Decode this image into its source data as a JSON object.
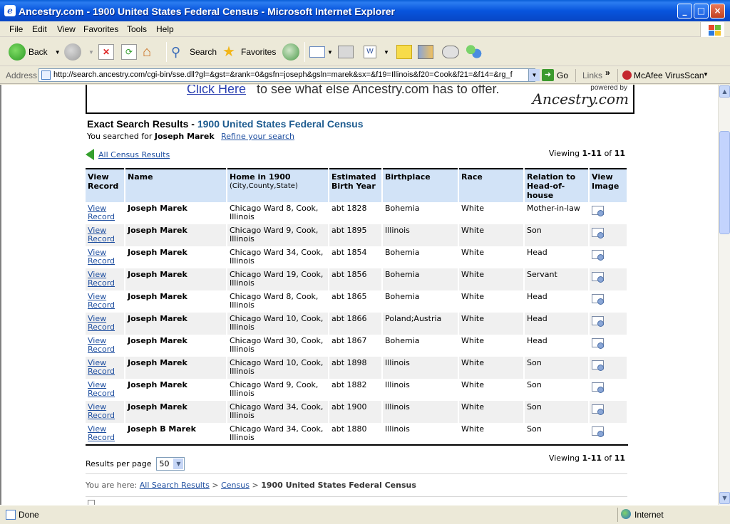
{
  "window": {
    "title": "Ancestry.com - 1900 United States Federal Census - Microsoft Internet Explorer",
    "minimize": "_",
    "maximize": "□",
    "close": "×"
  },
  "menu": [
    "File",
    "Edit",
    "View",
    "Favorites",
    "Tools",
    "Help"
  ],
  "toolbar": {
    "back_label": "Back",
    "search_label": "Search",
    "favorites_label": "Favorites"
  },
  "address": {
    "label": "Address",
    "url": "http://search.ancestry.com/cgi-bin/sse.dll?gl=&gst=&rank=0&gsfn=joseph&gsln=marek&sx=&f19=Illinois&f20=Cook&f21=&f14=&rg_f",
    "go_label": "Go",
    "links_label": "Links",
    "mcafee_label": "McAfee VirusScan"
  },
  "ad": {
    "link_text": "Click Here",
    "text": "to see what else Ancestry.com has to offer.",
    "powered_by": "powered by",
    "logo": "Ancestry.com"
  },
  "results": {
    "title": "Exact Search Results - ",
    "collection": "1900 United States Federal Census",
    "searched_prefix": "You searched for",
    "searched_name": "Joseph Marek",
    "refine": "Refine your search",
    "all_census": "All Census Results",
    "viewing_prefix": "Viewing",
    "viewing_range": "1-11",
    "viewing_of": "of",
    "viewing_total": "11"
  },
  "table": {
    "headers": {
      "view_record": "View Record",
      "name": "Name",
      "home": "Home in 1900",
      "home_sub": "(City,County,State)",
      "birth_year": "Estimated Birth Year",
      "birthplace": "Birthplace",
      "race": "Race",
      "relation": "Relation to Head-of-house",
      "view_image": "View Image"
    },
    "rows": [
      {
        "view": "View Record",
        "name": "Joseph Marek",
        "home": "Chicago Ward 8, Cook, Illinois",
        "year": "abt 1828",
        "birthplace": "Bohemia",
        "race": "White",
        "relation": "Mother-in-law"
      },
      {
        "view": "View Record",
        "name": "Joseph Marek",
        "home": "Chicago Ward 9, Cook, Illinois",
        "year": "abt 1895",
        "birthplace": "Illinois",
        "race": "White",
        "relation": "Son"
      },
      {
        "view": "View Record",
        "name": "Joseph Marek",
        "home": "Chicago Ward 34, Cook, Illinois",
        "year": "abt 1854",
        "birthplace": "Bohemia",
        "race": "White",
        "relation": "Head"
      },
      {
        "view": "View Record",
        "name": "Joseph Marek",
        "home": "Chicago Ward 19, Cook, Illinois",
        "year": "abt 1856",
        "birthplace": "Bohemia",
        "race": "White",
        "relation": "Servant"
      },
      {
        "view": "View Record",
        "name": "Joseph Marek",
        "home": "Chicago Ward 8, Cook, Illinois",
        "year": "abt 1865",
        "birthplace": "Bohemia",
        "race": "White",
        "relation": "Head"
      },
      {
        "view": "View Record",
        "name": "Joseph Marek",
        "home": "Chicago Ward 10, Cook, Illinois",
        "year": "abt 1866",
        "birthplace": "Poland;Austria",
        "race": "White",
        "relation": "Head"
      },
      {
        "view": "View Record",
        "name": "Joseph Marek",
        "home": "Chicago Ward 30, Cook, Illinois",
        "year": "abt 1867",
        "birthplace": "Bohemia",
        "race": "White",
        "relation": "Head"
      },
      {
        "view": "View Record",
        "name": "Joseph Marek",
        "home": "Chicago Ward 10, Cook, Illinois",
        "year": "abt 1898",
        "birthplace": "Illinois",
        "race": "White",
        "relation": "Son"
      },
      {
        "view": "View Record",
        "name": "Joseph Marek",
        "home": "Chicago Ward 9, Cook, Illinois",
        "year": "abt 1882",
        "birthplace": "Illinois",
        "race": "White",
        "relation": "Son"
      },
      {
        "view": "View Record",
        "name": "Joseph Marek",
        "home": "Chicago Ward 34, Cook, Illinois",
        "year": "abt 1900",
        "birthplace": "Illinois",
        "race": "White",
        "relation": "Son"
      },
      {
        "view": "View Record",
        "name": "Joseph B Marek",
        "home": "Chicago Ward 34, Cook, Illinois",
        "year": "abt 1880",
        "birthplace": "Illinois",
        "race": "White",
        "relation": "Son"
      }
    ]
  },
  "pagination": {
    "results_per_page_label": "Results per page",
    "results_per_page_value": "50"
  },
  "breadcrumb": {
    "prefix": "You are here:",
    "all_results": "All Search Results",
    "sep": ">",
    "census": "Census",
    "current": "1900 United States Federal Census"
  },
  "status": {
    "text": "Done",
    "zone": "Internet"
  }
}
